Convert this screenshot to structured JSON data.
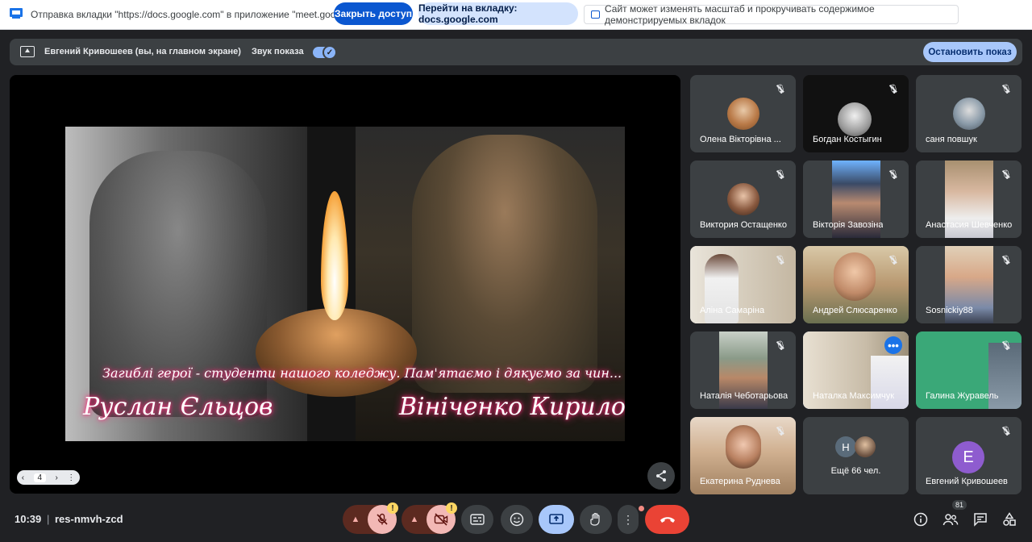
{
  "share_bar": {
    "message": "Отправка вкладки \"https://docs.google.com\" в приложение \"meet.google.com\"...",
    "stop_access": "Закрыть доступ",
    "go_to_tab": "Перейти на вкладку: docs.google.com",
    "zoom_notice": "Сайт может изменять масштаб и прокручивать содержимое демонстрируемых вкладок"
  },
  "presenting_bar": {
    "presenter": "Евгений Кривошеев (вы, на главном экране)",
    "sound_label": "Звук показа",
    "sound_on": true,
    "stop_button": "Остановить показ"
  },
  "slide": {
    "caption": "Загиблі герої - студенти нашого коледжу. Пам'ятаємо і дякуємо за чин...",
    "name_left": "Руслан Єльцов",
    "name_right": "Вініченко Кирило",
    "page": "4"
  },
  "participants": [
    {
      "name": "Олена Вікторівна ...",
      "muted": true
    },
    {
      "name": "Богдан Костыгин",
      "muted": true
    },
    {
      "name": "саня повшук",
      "muted": true
    },
    {
      "name": "Виктория Остащенко",
      "muted": true
    },
    {
      "name": "Вікторія Завозіна",
      "muted": true
    },
    {
      "name": "Анастасия Шевченко",
      "muted": true
    },
    {
      "name": "Аліна Самаріна",
      "muted": true
    },
    {
      "name": "Андрей Слюсаренко",
      "muted": true
    },
    {
      "name": "Sosnickiy88",
      "muted": true
    },
    {
      "name": "Наталія Чеботарьова",
      "muted": true
    },
    {
      "name": "Наталка Максимчук",
      "muted": false
    },
    {
      "name": "Галина Журавель",
      "muted": true
    },
    {
      "name": "Екатерина Руднева",
      "muted": true
    },
    {
      "name": "Евгений Кривошеев",
      "muted": true
    }
  ],
  "more_tile": {
    "text": "Ещё 66 чел.",
    "avatar_letter": "Н"
  },
  "self_letter": "Е",
  "bottom": {
    "time": "10:39",
    "separator": "|",
    "meeting_code": "res-nmvh-zcd",
    "people_count": "81"
  }
}
